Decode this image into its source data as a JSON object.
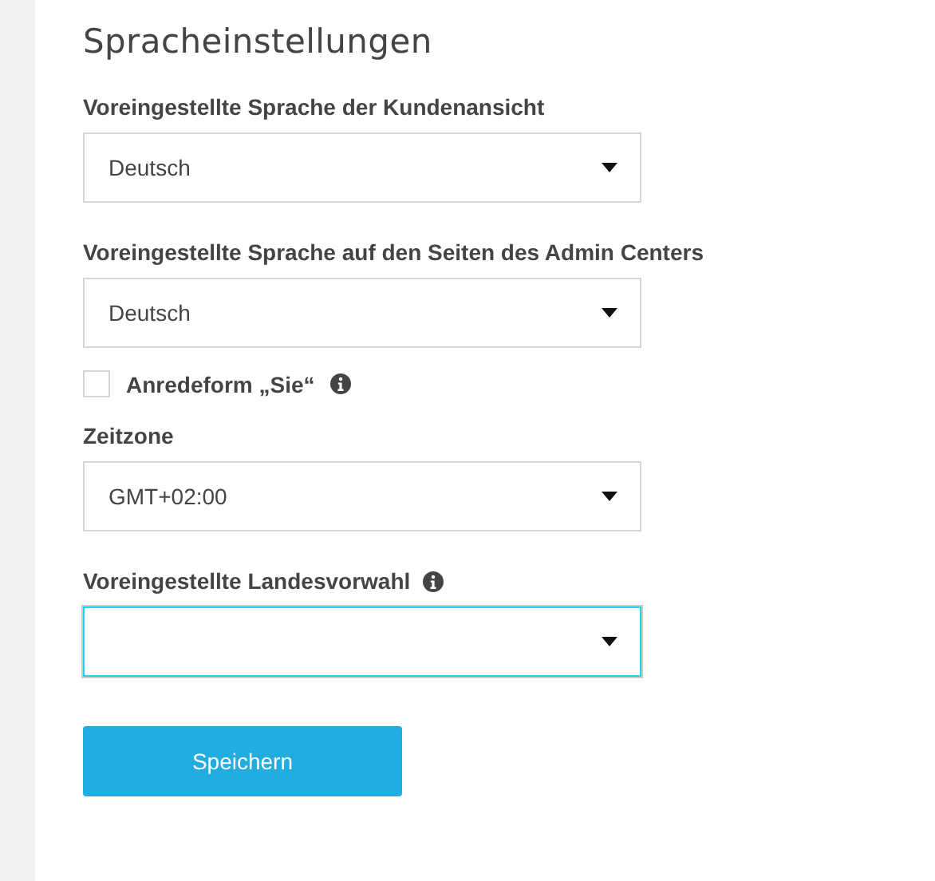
{
  "title": "Spracheinstellungen",
  "fields": [
    {
      "kind": "select",
      "label": "Voreingestellte Sprache der Kundenansicht",
      "info": false,
      "value": "Deutsch",
      "focused": false
    },
    {
      "kind": "select",
      "label": "Voreingestellte Sprache auf den Seiten des Admin Centers",
      "info": false,
      "value": "Deutsch",
      "focused": false
    },
    {
      "kind": "checkbox",
      "label": "Anredeform „Sie“",
      "info": true,
      "checked": false
    },
    {
      "kind": "select",
      "label": "Zeitzone",
      "info": false,
      "value": "GMT+02:00",
      "focused": false
    },
    {
      "kind": "select",
      "label": "Voreingestellte Landesvorwahl",
      "info": true,
      "focused": true
    }
  ],
  "save_button": "Speichern"
}
